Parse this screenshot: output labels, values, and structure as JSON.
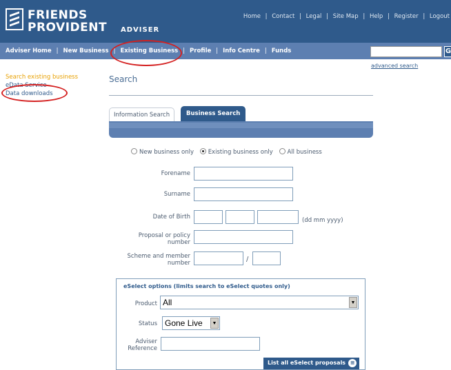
{
  "header": {
    "brand_line1": "FRIENDS",
    "brand_line2": "PROVIDENT",
    "brand_sub": "ADVISER",
    "utility_links": [
      "Home",
      "Contact",
      "Legal",
      "Site Map",
      "Help",
      "Register",
      "Logout"
    ],
    "separator": "|"
  },
  "nav": {
    "items": [
      "Adviser Home",
      "New Business",
      "Existing Business",
      "Profile",
      "Info Centre",
      "Funds"
    ],
    "separator": "|"
  },
  "search": {
    "go_glyph": "G",
    "advanced_link": "advanced search"
  },
  "leftnav": {
    "items": [
      "Search existing business",
      "eData Service",
      "Data downloads"
    ]
  },
  "page": {
    "title": "Search"
  },
  "tabs": [
    "Information Search",
    "Business Search"
  ],
  "radios": {
    "options": [
      "New business only",
      "Existing business only",
      "All business"
    ],
    "selected_index": 1
  },
  "form": {
    "forename_label": "Forename",
    "surname_label": "Surname",
    "dob_label": "Date of Birth",
    "dob_hint": "(dd mm yyyy)",
    "proposal_label_1": "Proposal or policy",
    "proposal_label_2": "number",
    "scheme_label_1": "Scheme and member",
    "scheme_label_2": "number",
    "slash": "/"
  },
  "eselect": {
    "title": "eSelect options (limits search to eSelect quotes only)",
    "product_label": "Product",
    "product_value": "All",
    "status_label": "Status",
    "status_value": "Gone Live",
    "adviser_ref_label_1": "Adviser",
    "adviser_ref_label_2": "Reference",
    "list_button": "List all eSelect proposals"
  },
  "colors": {
    "header_bg": "#2f5a8b",
    "nav_bg": "#5d7fb1",
    "annotation": "#d42020",
    "active_link": "#e8a000"
  }
}
